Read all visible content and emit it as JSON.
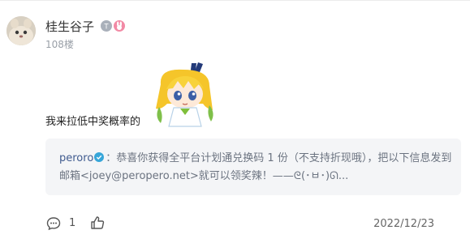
{
  "user": {
    "name": "桂生谷子",
    "floor": "108楼",
    "badges": [
      {
        "icon": "level-badge-icon",
        "color": "#a9b0ba",
        "glyph": "T"
      },
      {
        "icon": "rabbit-badge-icon",
        "color": "#f28aa5"
      }
    ]
  },
  "comment": {
    "text": "我来拉低中奖概率的",
    "sticker": "anime-girl-sticker"
  },
  "quote": {
    "author": "peroro",
    "verified_icon": "verified-icon",
    "text": "：恭喜你获得全平台计划通兑换码 1 份（不支持折现哦），把以下信息发到邮箱<joey@peropero.net>就可以领奖辣！——ᘓ(･ㅂ･)ᘏ..."
  },
  "footer": {
    "reply_icon": "reply-icon",
    "reply_count": "1",
    "like_icon": "like-icon",
    "date": "2022/12/23"
  }
}
